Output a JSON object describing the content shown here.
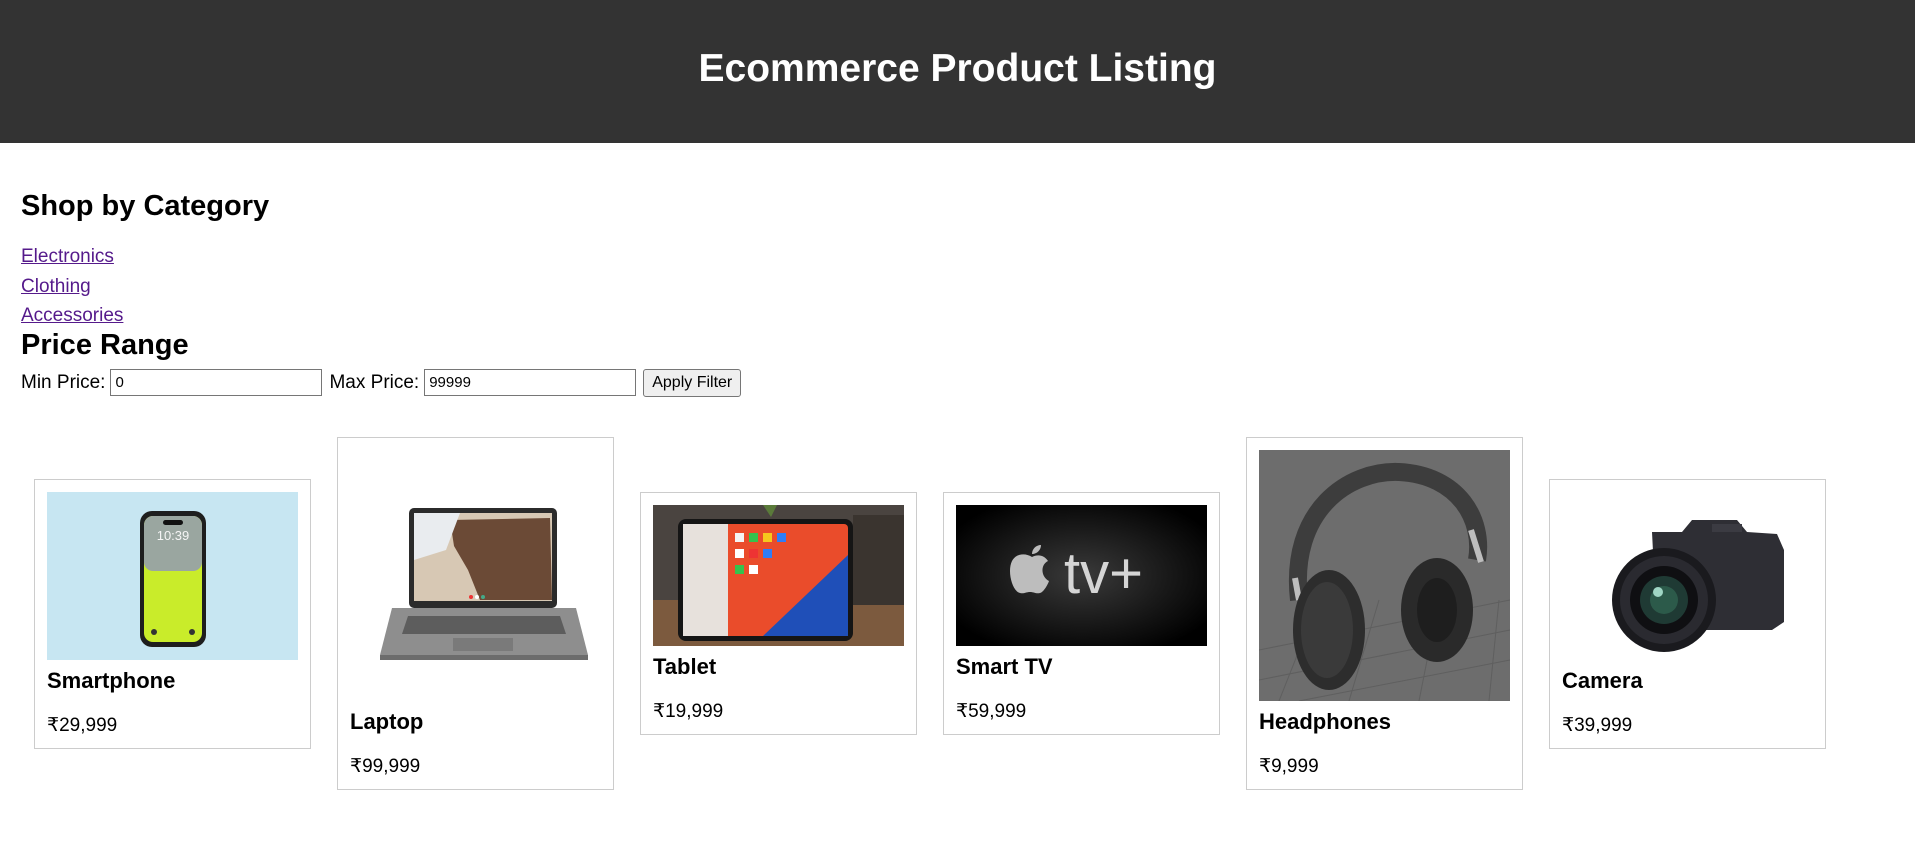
{
  "header": {
    "title": "Ecommerce Product Listing"
  },
  "categories": {
    "title": "Shop by Category",
    "links": [
      "Electronics",
      "Clothing",
      "Accessories"
    ]
  },
  "price_filter": {
    "title": "Price Range",
    "min_label": "Min Price:",
    "min_value": "0",
    "max_label": "Max Price:",
    "max_value": "99999",
    "apply_label": "Apply Filter"
  },
  "products": [
    {
      "name": "Smartphone",
      "price": "₹29,999"
    },
    {
      "name": "Laptop",
      "price": "₹99,999"
    },
    {
      "name": "Tablet",
      "price": "₹19,999"
    },
    {
      "name": "Smart TV",
      "price": "₹59,999"
    },
    {
      "name": "Headphones",
      "price": "₹9,999"
    },
    {
      "name": "Camera",
      "price": "₹39,999"
    }
  ],
  "colors": {
    "header_bg": "#333333",
    "link": "#551a8b"
  }
}
